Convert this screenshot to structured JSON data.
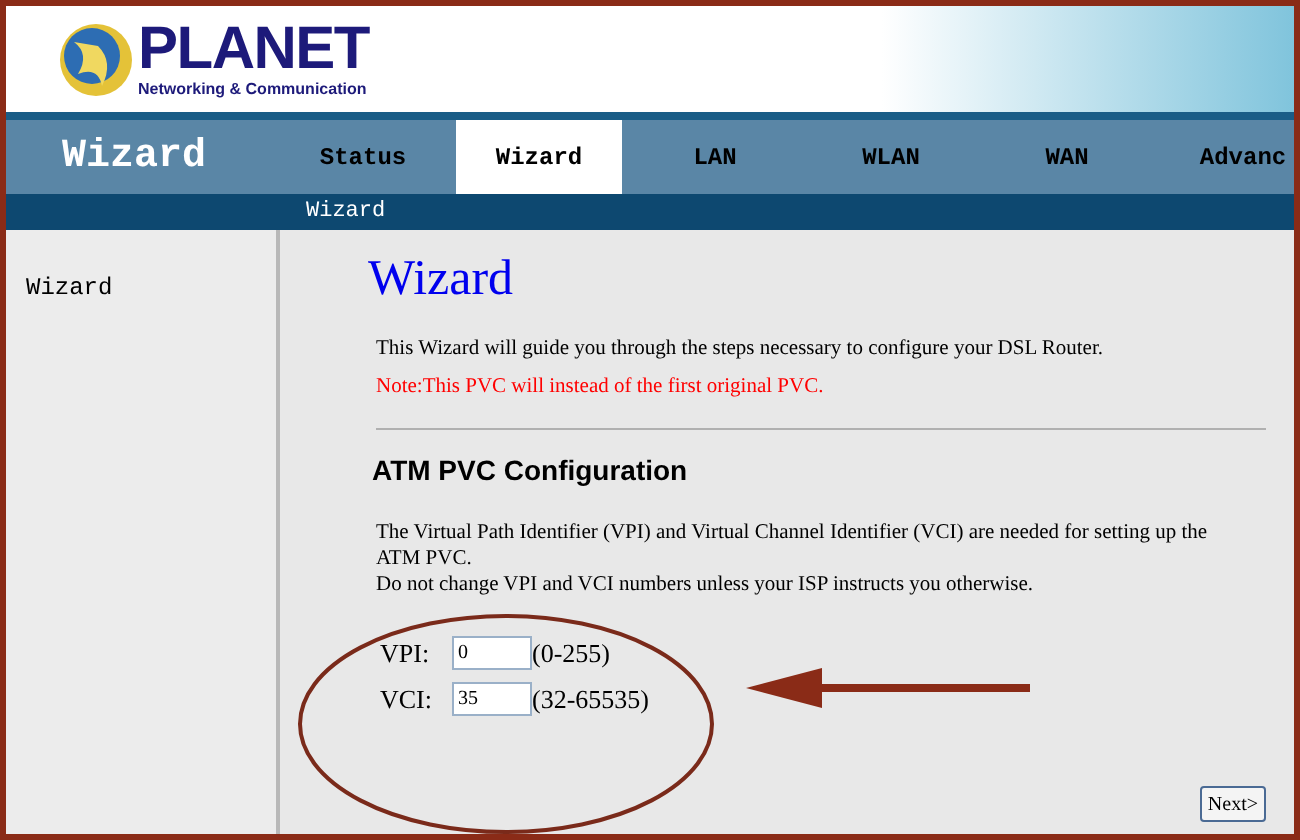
{
  "logo": {
    "name": "PLANET",
    "tagline": "Networking & Communication"
  },
  "nav": {
    "title": "Wizard",
    "tabs": [
      {
        "label": "Status",
        "selected": false
      },
      {
        "label": "Wizard",
        "selected": true
      },
      {
        "label": "LAN",
        "selected": false
      },
      {
        "label": "WLAN",
        "selected": false
      },
      {
        "label": "WAN",
        "selected": false
      },
      {
        "label": "Advanc",
        "selected": false
      }
    ]
  },
  "subnav": {
    "items": [
      "Wizard"
    ]
  },
  "sidebar": {
    "items": [
      {
        "label": "Wizard"
      }
    ]
  },
  "content": {
    "heading": "Wizard",
    "intro": "This Wizard will guide you through the steps necessary to configure your DSL Router.",
    "note": "Note:This PVC will instead of the first original PVC.",
    "section_title": "ATM PVC Configuration",
    "description": [
      "The Virtual Path Identifier (VPI) and Virtual Channel Identifier (VCI) are needed for setting up the ATM PVC.",
      "Do not change VPI and VCI numbers unless your ISP instructs you otherwise."
    ],
    "fields": [
      {
        "label": "VPI:",
        "value": "0",
        "range": "(0-255)"
      },
      {
        "label": "VCI:",
        "value": "35",
        "range": "(32-65535)"
      }
    ],
    "next_button": "Next>"
  }
}
